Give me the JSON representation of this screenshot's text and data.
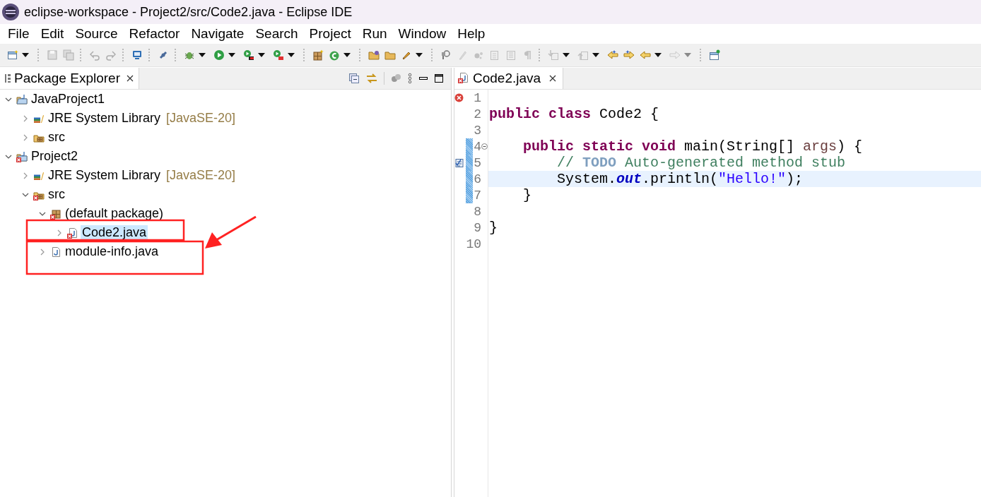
{
  "window": {
    "title": "eclipse-workspace - Project2/src/Code2.java - Eclipse IDE"
  },
  "menu": [
    {
      "label": "File"
    },
    {
      "label": "Edit"
    },
    {
      "label": "Source"
    },
    {
      "label": "Refactor"
    },
    {
      "label": "Navigate"
    },
    {
      "label": "Search"
    },
    {
      "label": "Project"
    },
    {
      "label": "Run"
    },
    {
      "label": "Window"
    },
    {
      "label": "Help"
    }
  ],
  "toolbar": [
    {
      "kind": "button",
      "disabled": false
    },
    {
      "kind": "dropdown",
      "disabled": false
    },
    {
      "kind": "separator"
    },
    {
      "kind": "button",
      "disabled": true
    },
    {
      "kind": "button",
      "disabled": true
    },
    {
      "kind": "separator"
    },
    {
      "kind": "button",
      "disabled": true
    },
    {
      "kind": "button",
      "disabled": true
    },
    {
      "kind": "separator"
    },
    {
      "kind": "button",
      "disabled": false
    },
    {
      "kind": "separator"
    },
    {
      "kind": "button",
      "disabled": false
    },
    {
      "kind": "separator"
    },
    {
      "kind": "button",
      "disabled": false
    },
    {
      "kind": "dropdown",
      "disabled": false
    },
    {
      "kind": "button",
      "disabled": false
    },
    {
      "kind": "dropdown",
      "disabled": false
    },
    {
      "kind": "button",
      "disabled": false
    },
    {
      "kind": "dropdown",
      "disabled": false
    },
    {
      "kind": "button",
      "disabled": false
    },
    {
      "kind": "dropdown",
      "disabled": false
    },
    {
      "kind": "separator"
    },
    {
      "kind": "button",
      "disabled": false
    },
    {
      "kind": "button",
      "disabled": false
    },
    {
      "kind": "dropdown",
      "disabled": false
    },
    {
      "kind": "separator"
    },
    {
      "kind": "button",
      "disabled": false
    },
    {
      "kind": "button",
      "disabled": false
    },
    {
      "kind": "button",
      "disabled": false
    },
    {
      "kind": "dropdown",
      "disabled": false
    },
    {
      "kind": "separator"
    },
    {
      "kind": "button",
      "disabled": false
    },
    {
      "kind": "button",
      "disabled": true
    },
    {
      "kind": "button",
      "disabled": true
    },
    {
      "kind": "button",
      "disabled": true
    },
    {
      "kind": "button",
      "disabled": true
    },
    {
      "kind": "button",
      "disabled": true
    },
    {
      "kind": "separator"
    },
    {
      "kind": "button",
      "disabled": true
    },
    {
      "kind": "dropdown",
      "disabled": false
    },
    {
      "kind": "button",
      "disabled": true
    },
    {
      "kind": "dropdown",
      "disabled": false
    },
    {
      "kind": "button",
      "disabled": false
    },
    {
      "kind": "button",
      "disabled": false
    },
    {
      "kind": "button",
      "disabled": false
    },
    {
      "kind": "dropdown",
      "disabled": false
    },
    {
      "kind": "button",
      "disabled": true
    },
    {
      "kind": "dropdown",
      "disabled": true
    },
    {
      "kind": "separator"
    },
    {
      "kind": "button",
      "disabled": false
    }
  ],
  "explorer": {
    "tab": {
      "label": "Package Explorer",
      "selected": true
    },
    "tree": [
      {
        "kind": "project",
        "label": "JavaProject1",
        "expanded": true,
        "error": false,
        "selected": false,
        "children": [
          {
            "kind": "library",
            "label": "JRE System Library",
            "qualifier": "[JavaSE-20]",
            "expanded": false,
            "error": false,
            "selected": false
          },
          {
            "kind": "source-folder",
            "label": "src",
            "expanded": false,
            "error": false,
            "selected": false
          }
        ]
      },
      {
        "kind": "project",
        "label": "Project2",
        "expanded": true,
        "error": true,
        "selected": false,
        "children": [
          {
            "kind": "library",
            "label": "JRE System Library",
            "qualifier": "[JavaSE-20]",
            "expanded": false,
            "error": false,
            "selected": false
          },
          {
            "kind": "source-folder",
            "label": "src",
            "expanded": true,
            "error": true,
            "selected": false,
            "children": [
              {
                "kind": "package",
                "label": "(default package)",
                "expanded": true,
                "error": true,
                "selected": false,
                "children": [
                  {
                    "kind": "java-file",
                    "label": "Code2.java",
                    "expanded": false,
                    "error": true,
                    "selected": true
                  }
                ]
              },
              {
                "kind": "java-file",
                "label": "module-info.java",
                "expanded": false,
                "error": false,
                "selected": false
              }
            ]
          }
        ]
      }
    ]
  },
  "editor": {
    "tab": {
      "label": "Code2.java",
      "selected": true,
      "error": true
    },
    "lines": [
      {
        "number": "1",
        "error": true,
        "task": false,
        "changed": false,
        "current": false,
        "collapsible": false
      },
      {
        "number": "2",
        "error": false,
        "task": false,
        "changed": false,
        "current": false,
        "collapsible": false,
        "tokens": [
          {
            "kind": "keyword",
            "text": "public class"
          },
          {
            "kind": "plain",
            "text": " Code2 {"
          }
        ]
      },
      {
        "number": "3",
        "error": false,
        "task": false,
        "changed": false,
        "current": false,
        "collapsible": false
      },
      {
        "number": "4",
        "error": false,
        "task": false,
        "changed": true,
        "current": false,
        "collapsible": true,
        "tokens": [
          {
            "kind": "keyword",
            "text": "    public static void"
          },
          {
            "kind": "plain",
            "text": " main(String[] "
          },
          {
            "kind": "param",
            "text": "args"
          },
          {
            "kind": "plain",
            "text": ") {"
          }
        ]
      },
      {
        "number": "5",
        "error": false,
        "task": true,
        "changed": true,
        "current": false,
        "collapsible": false,
        "tokens": [
          {
            "kind": "comment",
            "text": "        // "
          },
          {
            "kind": "todo",
            "text": "TODO"
          },
          {
            "kind": "comment",
            "text": " Auto-generated method stub"
          }
        ]
      },
      {
        "number": "6",
        "error": false,
        "task": false,
        "changed": true,
        "current": true,
        "collapsible": false,
        "tokens": [
          {
            "kind": "plain",
            "text": "        System."
          },
          {
            "kind": "field",
            "text": "out"
          },
          {
            "kind": "plain",
            "text": ".println("
          },
          {
            "kind": "string",
            "text": "\"Hello!\""
          },
          {
            "kind": "plain",
            "text": ");"
          }
        ]
      },
      {
        "number": "7",
        "error": false,
        "task": false,
        "changed": true,
        "current": false,
        "collapsible": false,
        "tokens": [
          {
            "kind": "plain",
            "text": "    }"
          }
        ]
      },
      {
        "number": "8",
        "error": false,
        "task": false,
        "changed": false,
        "current": false,
        "collapsible": false
      },
      {
        "number": "9",
        "error": false,
        "task": false,
        "changed": false,
        "current": false,
        "collapsible": false,
        "tokens": [
          {
            "kind": "plain",
            "text": "}"
          }
        ]
      },
      {
        "number": "10",
        "error": false,
        "task": false,
        "changed": false,
        "current": false,
        "collapsible": false
      }
    ]
  },
  "annotations": [
    {
      "kind": "box"
    },
    {
      "kind": "box"
    },
    {
      "kind": "arrow"
    }
  ]
}
